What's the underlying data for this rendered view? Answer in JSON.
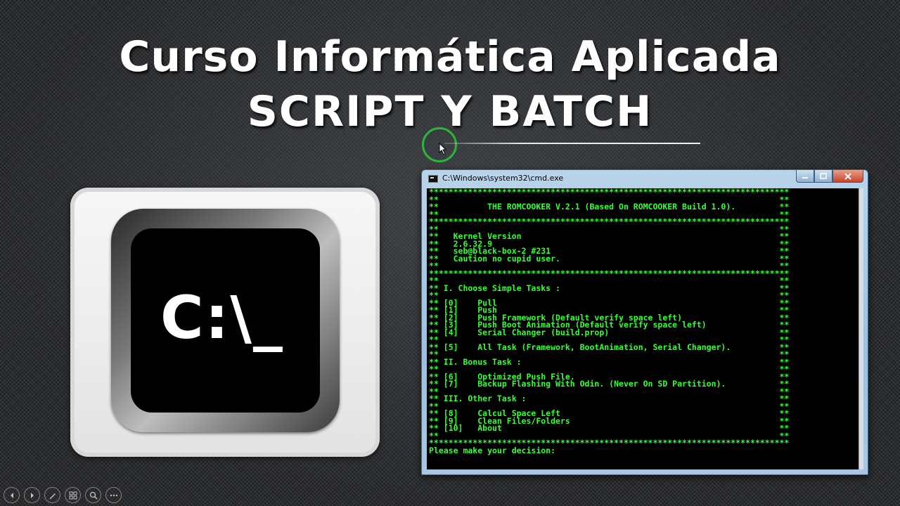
{
  "slide": {
    "title_line1": "Curso Informática Aplicada",
    "title_line2": "SCRIPT Y BATCH"
  },
  "key_icon": {
    "prompt": "C:\\_",
    "icon": "command-prompt-icon"
  },
  "cmd_window": {
    "title": "C:\\Windows\\system32\\cmd.exe",
    "lines": [
      "**************************************************************************",
      "**                                                                      **",
      "**          THE ROMCOOKER V.2.1 (Based On ROMCOOKER Build 1.0).         **",
      "**                                                                      **",
      "**************************************************************************",
      "**                                                                      **",
      "**   Kernel Version                                                     **",
      "**   2.6.32.9                                                           **",
      "**   seb@black-box-2 #231                                               **",
      "**   Caution no cupid user.                                             **",
      "**                                                                      **",
      "**************************************************************************",
      "**                                                                      **",
      "** I. Choose Simple Tasks :                                             **",
      "**                                                                      **",
      "** [0]    Pull                                                          **",
      "** [1]    Push                                                          **",
      "** [2]    Push Framework (Default verify space left)                    **",
      "** [3]    Push Boot Animation (Default verify space left)               **",
      "** [4]    Serial Changer (build.prop)                                   **",
      "**                                                                      **",
      "** [5]    All Task (Framework, BootAnimation, Serial Changer).          **",
      "**                                                                      **",
      "** II. Bonus Task :                                                     **",
      "**                                                                      **",
      "** [6]    Optimized Push File.                                          **",
      "** [7]    Backup Flashing With Odin. (Never On SD Partition).           **",
      "**                                                                      **",
      "** III. Other Task :                                                    **",
      "**                                                                      **",
      "** [8]    Calcul Space Left                                             **",
      "** [9]    Clean Files/Folders                                           **",
      "** [10]   About                                                         **",
      "**                                                                      **",
      "**************************************************************************",
      "Please make your decision:"
    ]
  },
  "toolbar": {
    "buttons": [
      {
        "name": "previous-slide-button",
        "icon": "arrow-left-icon"
      },
      {
        "name": "next-slide-button",
        "icon": "arrow-right-icon"
      },
      {
        "name": "pen-tool-button",
        "icon": "pen-icon"
      },
      {
        "name": "slide-sorter-button",
        "icon": "grid-icon"
      },
      {
        "name": "zoom-button",
        "icon": "magnifier-icon"
      },
      {
        "name": "more-options-button",
        "icon": "ellipsis-icon"
      }
    ]
  },
  "colors": {
    "console_text": "#33ff33",
    "cursor_ring": "#2fb43a",
    "console_bg": "#000000"
  }
}
